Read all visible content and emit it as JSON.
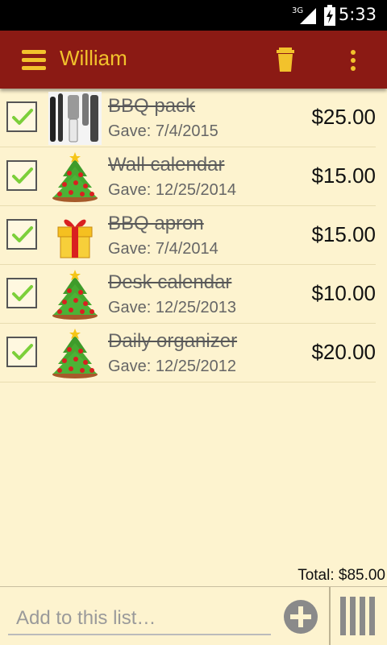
{
  "status_bar": {
    "network": "3G",
    "time": "5:33"
  },
  "app_bar": {
    "title": "William",
    "menu_icon": "hamburger-menu-icon",
    "trash_icon": "trash-icon",
    "overflow_icon": "overflow-menu-icon",
    "accent_color": "#f2c22c",
    "bar_color": "#8b1a14"
  },
  "items": [
    {
      "name": "BBQ pack",
      "date": "Gave: 7/4/2015",
      "price": "$25.00",
      "checked": true,
      "thumb": "bbq-tools"
    },
    {
      "name": "Wall calendar",
      "date": "Gave: 12/25/2014",
      "price": "$15.00",
      "checked": true,
      "thumb": "christmas-tree"
    },
    {
      "name": "BBQ apron",
      "date": "Gave: 7/4/2014",
      "price": "$15.00",
      "checked": true,
      "thumb": "gift-box"
    },
    {
      "name": "Desk calendar",
      "date": "Gave: 12/25/2013",
      "price": "$10.00",
      "checked": true,
      "thumb": "christmas-tree"
    },
    {
      "name": "Daily organizer",
      "date": "Gave: 12/25/2012",
      "price": "$20.00",
      "checked": true,
      "thumb": "christmas-tree"
    }
  ],
  "total": "Total: $85.00",
  "bottom_bar": {
    "input_placeholder": "Add to this list…",
    "input_value": "",
    "add_icon": "plus-circle-icon",
    "barcode_icon": "barcode-scan-icon"
  }
}
